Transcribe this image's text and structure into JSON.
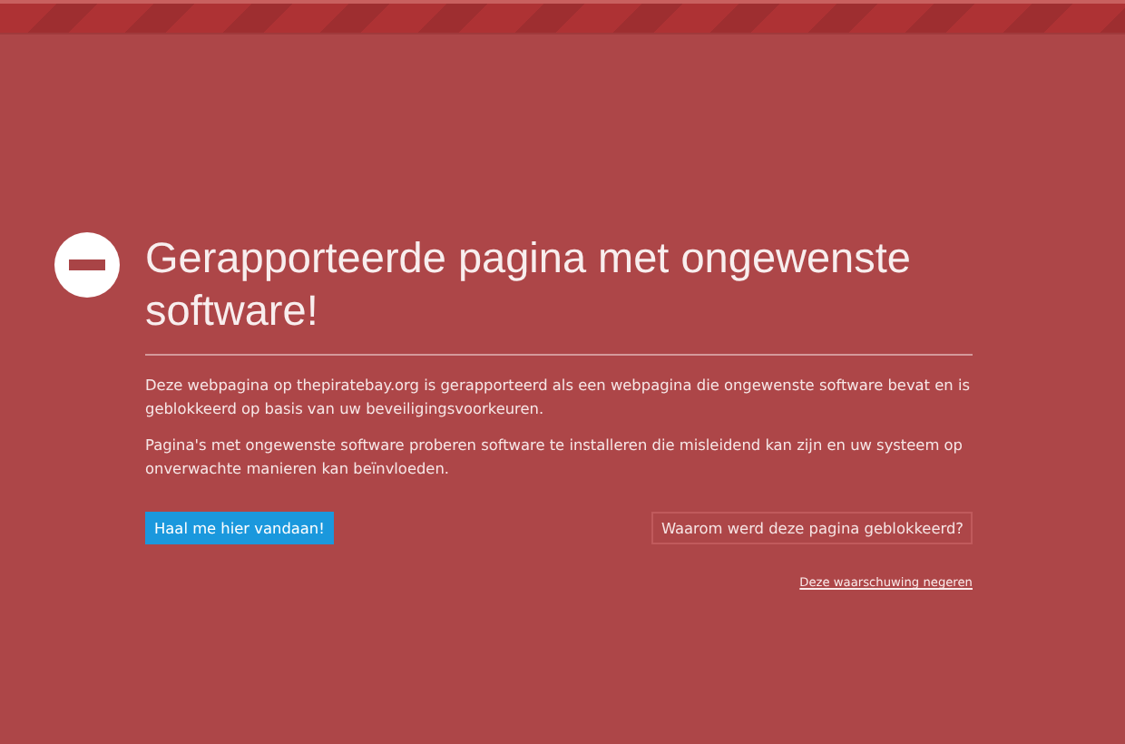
{
  "warning": {
    "title": "Gerapporteerde pagina met ongewenste software!",
    "paragraphs": [
      "Deze webpagina op thepiratebay.org is gerapporteerd als een webpagina die ongewenste software bevat en is geblokkeerd op basis van uw beveiligingsvoorkeuren.",
      "Pagina's met ongewenste software proberen software te installeren die misleidend kan zijn en uw systeem op onverwachte manieren kan beïnvloeden."
    ],
    "primary_button": "Haal me hier vandaan!",
    "secondary_button": "Waarom werd deze pagina geblokkeerd?",
    "ignore_link": "Deze waarschuwing negeren"
  }
}
